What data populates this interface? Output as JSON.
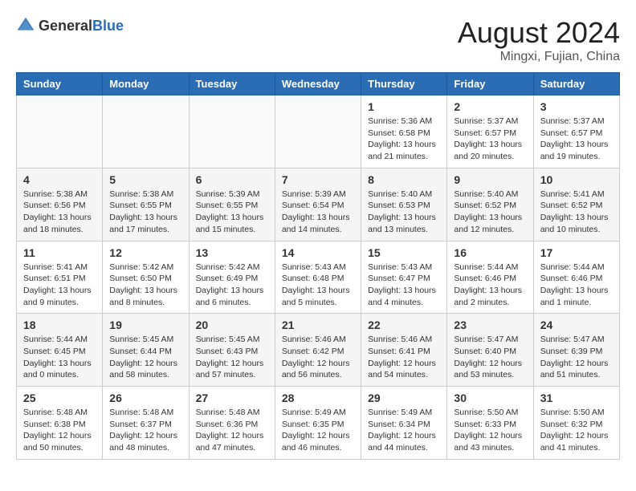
{
  "header": {
    "logo_general": "General",
    "logo_blue": "Blue",
    "month_year": "August 2024",
    "location": "Mingxi, Fujian, China"
  },
  "days_of_week": [
    "Sunday",
    "Monday",
    "Tuesday",
    "Wednesday",
    "Thursday",
    "Friday",
    "Saturday"
  ],
  "weeks": [
    [
      {
        "day": "",
        "info": ""
      },
      {
        "day": "",
        "info": ""
      },
      {
        "day": "",
        "info": ""
      },
      {
        "day": "",
        "info": ""
      },
      {
        "day": "1",
        "info": "Sunrise: 5:36 AM\nSunset: 6:58 PM\nDaylight: 13 hours\nand 21 minutes."
      },
      {
        "day": "2",
        "info": "Sunrise: 5:37 AM\nSunset: 6:57 PM\nDaylight: 13 hours\nand 20 minutes."
      },
      {
        "day": "3",
        "info": "Sunrise: 5:37 AM\nSunset: 6:57 PM\nDaylight: 13 hours\nand 19 minutes."
      }
    ],
    [
      {
        "day": "4",
        "info": "Sunrise: 5:38 AM\nSunset: 6:56 PM\nDaylight: 13 hours\nand 18 minutes."
      },
      {
        "day": "5",
        "info": "Sunrise: 5:38 AM\nSunset: 6:55 PM\nDaylight: 13 hours\nand 17 minutes."
      },
      {
        "day": "6",
        "info": "Sunrise: 5:39 AM\nSunset: 6:55 PM\nDaylight: 13 hours\nand 15 minutes."
      },
      {
        "day": "7",
        "info": "Sunrise: 5:39 AM\nSunset: 6:54 PM\nDaylight: 13 hours\nand 14 minutes."
      },
      {
        "day": "8",
        "info": "Sunrise: 5:40 AM\nSunset: 6:53 PM\nDaylight: 13 hours\nand 13 minutes."
      },
      {
        "day": "9",
        "info": "Sunrise: 5:40 AM\nSunset: 6:52 PM\nDaylight: 13 hours\nand 12 minutes."
      },
      {
        "day": "10",
        "info": "Sunrise: 5:41 AM\nSunset: 6:52 PM\nDaylight: 13 hours\nand 10 minutes."
      }
    ],
    [
      {
        "day": "11",
        "info": "Sunrise: 5:41 AM\nSunset: 6:51 PM\nDaylight: 13 hours\nand 9 minutes."
      },
      {
        "day": "12",
        "info": "Sunrise: 5:42 AM\nSunset: 6:50 PM\nDaylight: 13 hours\nand 8 minutes."
      },
      {
        "day": "13",
        "info": "Sunrise: 5:42 AM\nSunset: 6:49 PM\nDaylight: 13 hours\nand 6 minutes."
      },
      {
        "day": "14",
        "info": "Sunrise: 5:43 AM\nSunset: 6:48 PM\nDaylight: 13 hours\nand 5 minutes."
      },
      {
        "day": "15",
        "info": "Sunrise: 5:43 AM\nSunset: 6:47 PM\nDaylight: 13 hours\nand 4 minutes."
      },
      {
        "day": "16",
        "info": "Sunrise: 5:44 AM\nSunset: 6:46 PM\nDaylight: 13 hours\nand 2 minutes."
      },
      {
        "day": "17",
        "info": "Sunrise: 5:44 AM\nSunset: 6:46 PM\nDaylight: 13 hours\nand 1 minute."
      }
    ],
    [
      {
        "day": "18",
        "info": "Sunrise: 5:44 AM\nSunset: 6:45 PM\nDaylight: 13 hours\nand 0 minutes."
      },
      {
        "day": "19",
        "info": "Sunrise: 5:45 AM\nSunset: 6:44 PM\nDaylight: 12 hours\nand 58 minutes."
      },
      {
        "day": "20",
        "info": "Sunrise: 5:45 AM\nSunset: 6:43 PM\nDaylight: 12 hours\nand 57 minutes."
      },
      {
        "day": "21",
        "info": "Sunrise: 5:46 AM\nSunset: 6:42 PM\nDaylight: 12 hours\nand 56 minutes."
      },
      {
        "day": "22",
        "info": "Sunrise: 5:46 AM\nSunset: 6:41 PM\nDaylight: 12 hours\nand 54 minutes."
      },
      {
        "day": "23",
        "info": "Sunrise: 5:47 AM\nSunset: 6:40 PM\nDaylight: 12 hours\nand 53 minutes."
      },
      {
        "day": "24",
        "info": "Sunrise: 5:47 AM\nSunset: 6:39 PM\nDaylight: 12 hours\nand 51 minutes."
      }
    ],
    [
      {
        "day": "25",
        "info": "Sunrise: 5:48 AM\nSunset: 6:38 PM\nDaylight: 12 hours\nand 50 minutes."
      },
      {
        "day": "26",
        "info": "Sunrise: 5:48 AM\nSunset: 6:37 PM\nDaylight: 12 hours\nand 48 minutes."
      },
      {
        "day": "27",
        "info": "Sunrise: 5:48 AM\nSunset: 6:36 PM\nDaylight: 12 hours\nand 47 minutes."
      },
      {
        "day": "28",
        "info": "Sunrise: 5:49 AM\nSunset: 6:35 PM\nDaylight: 12 hours\nand 46 minutes."
      },
      {
        "day": "29",
        "info": "Sunrise: 5:49 AM\nSunset: 6:34 PM\nDaylight: 12 hours\nand 44 minutes."
      },
      {
        "day": "30",
        "info": "Sunrise: 5:50 AM\nSunset: 6:33 PM\nDaylight: 12 hours\nand 43 minutes."
      },
      {
        "day": "31",
        "info": "Sunrise: 5:50 AM\nSunset: 6:32 PM\nDaylight: 12 hours\nand 41 minutes."
      }
    ]
  ]
}
